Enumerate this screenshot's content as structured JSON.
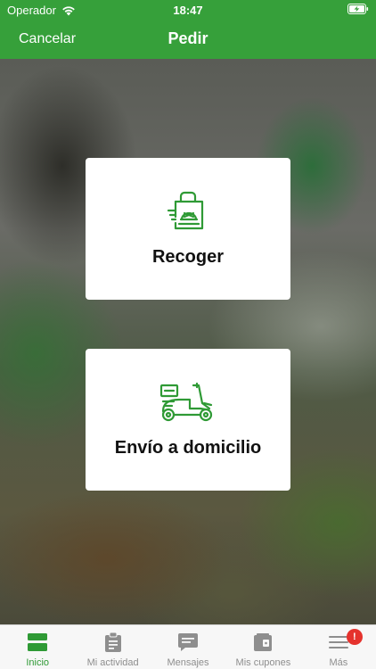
{
  "status_bar": {
    "carrier": "Operador",
    "time": "18:47",
    "wifi_icon": "wifi-icon",
    "battery_icon": "battery-charging-icon"
  },
  "nav": {
    "cancel_label": "Cancelar",
    "title": "Pedir"
  },
  "options": [
    {
      "label": "Recoger",
      "icon": "pickup-bag-icon"
    },
    {
      "label": "Envío a domicilio",
      "icon": "delivery-scooter-icon"
    }
  ],
  "tab_bar": {
    "items": [
      {
        "label": "Inicio",
        "icon": "home-icon",
        "active": true
      },
      {
        "label": "Mi actividad",
        "icon": "clipboard-icon",
        "active": false
      },
      {
        "label": "Mensajes",
        "icon": "message-icon",
        "active": false
      },
      {
        "label": "Mis cupones",
        "icon": "wallet-icon",
        "active": false
      },
      {
        "label": "Más",
        "icon": "menu-icon",
        "active": false,
        "badge": "!"
      }
    ]
  },
  "colors": {
    "brand_green": "#36a03a",
    "tab_active": "#2f9a35",
    "tab_inactive": "#8e8e8e",
    "badge_red": "#e5322d"
  }
}
